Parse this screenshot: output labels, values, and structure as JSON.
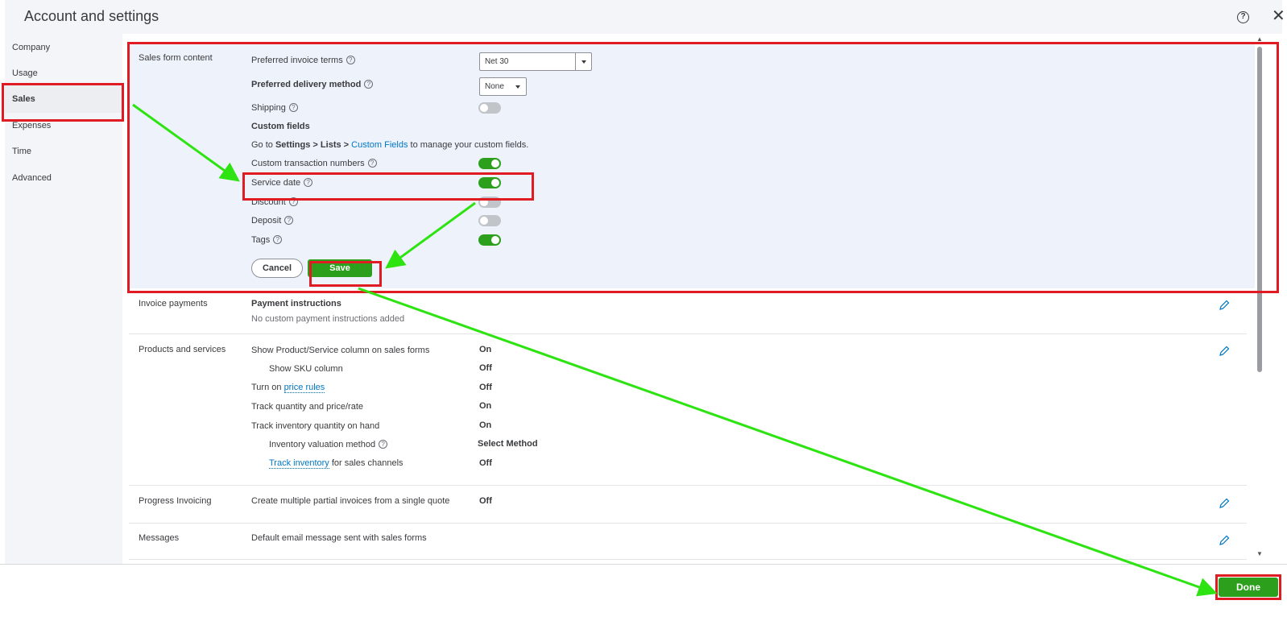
{
  "window": {
    "title": "Account and settings"
  },
  "sidebar": {
    "items": [
      {
        "label": "Company"
      },
      {
        "label": "Usage"
      },
      {
        "label": "Sales"
      },
      {
        "label": "Expenses"
      },
      {
        "label": "Time"
      },
      {
        "label": "Advanced"
      }
    ]
  },
  "sales_form_content": {
    "section_label": "Sales form content",
    "preferred_invoice_terms_label": "Preferred invoice terms",
    "preferred_invoice_terms_value": "Net 30",
    "preferred_delivery_method_label": "Preferred delivery method",
    "preferred_delivery_method_value": "None",
    "shipping_label": "Shipping",
    "custom_fields_label": "Custom fields",
    "custom_fields_note": {
      "prefix": "Go to ",
      "settings": "Settings",
      "sep1": " > ",
      "lists": "Lists",
      "sep2": " > ",
      "link": "Custom Fields",
      "suffix": " to manage your custom fields."
    },
    "custom_transaction_numbers_label": "Custom transaction numbers",
    "service_date_label": "Service date",
    "discount_label": "Discount",
    "deposit_label": "Deposit",
    "tags_label": "Tags",
    "cancel_label": "Cancel",
    "save_label": "Save"
  },
  "invoice_payments": {
    "section_label": "Invoice payments",
    "payment_instructions_label": "Payment instructions",
    "payment_instructions_value": "No custom payment instructions added"
  },
  "products_and_services": {
    "section_label": "Products and services",
    "rows": [
      {
        "label": "Show Product/Service column on sales forms",
        "value": "On"
      },
      {
        "label": "Show SKU column",
        "value": "Off"
      },
      {
        "label_prefix": "Turn on ",
        "label_link": "price rules",
        "value": "Off"
      },
      {
        "label": "Track quantity and price/rate",
        "value": "On"
      },
      {
        "label": "Track inventory quantity on hand",
        "value": "On"
      },
      {
        "label": "Inventory valuation method",
        "value": "Select Method"
      },
      {
        "label_link": "Track inventory",
        "label_suffix": " for sales channels",
        "value": "Off"
      }
    ]
  },
  "progress_invoicing": {
    "section_label": "Progress Invoicing",
    "label": "Create multiple partial invoices from a single quote",
    "value": "Off"
  },
  "messages": {
    "section_label": "Messages",
    "label": "Default email message sent with sales forms"
  },
  "footer": {
    "done_label": "Done"
  },
  "colors": {
    "accent_green": "#2ca01c",
    "highlight_red": "#e01b24",
    "arrow_green": "#2ee312",
    "link_blue": "#0077c5"
  }
}
